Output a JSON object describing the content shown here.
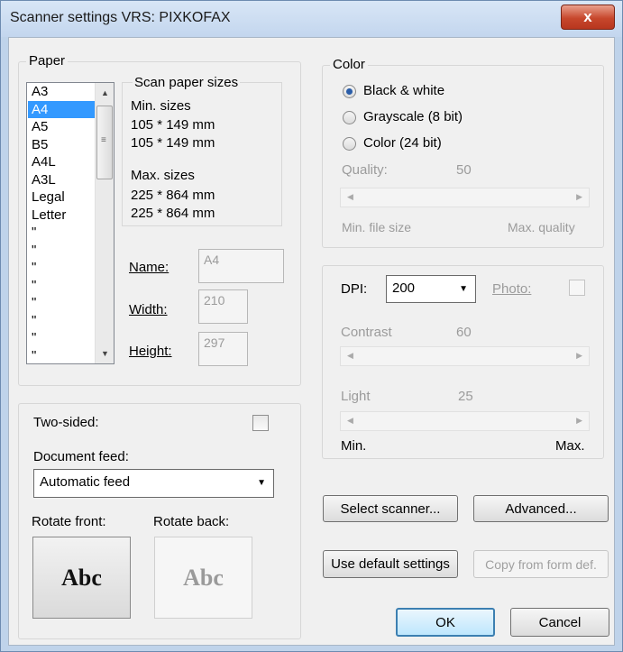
{
  "window": {
    "title": "Scanner settings  VRS: PIXKOFAX",
    "close_label": "x"
  },
  "paper": {
    "legend": "Paper",
    "list_items": [
      "A3",
      "A4",
      "A5",
      "B5",
      "A4L",
      "A3L",
      "Legal",
      "Letter",
      "\"",
      "\"",
      "\"",
      "\"",
      "\"",
      "\"",
      "\"",
      "\""
    ],
    "selected_index": 1,
    "sizes_legend": "Scan paper sizes",
    "min_label": "Min. sizes",
    "min_value_1": "105 * 149 mm",
    "min_value_2": "105 * 149 mm",
    "max_label": "Max. sizes",
    "max_value_1": "225 * 864 mm",
    "max_value_2": "225 * 864 mm",
    "name_label": "Name:",
    "name_value": "A4",
    "width_label": "Width:",
    "width_value": "210",
    "height_label": "Height:",
    "height_value": "297"
  },
  "feed": {
    "two_sided_label": "Two-sided:",
    "two_sided_checked": false,
    "document_feed_label": "Document feed:",
    "document_feed_value": "Automatic feed",
    "rotate_front_label": "Rotate front:",
    "rotate_back_label": "Rotate back:",
    "preview_text": "Abc"
  },
  "color": {
    "legend": "Color",
    "options": [
      "Black & white",
      "Grayscale (8 bit)",
      "Color (24 bit)"
    ],
    "selected_index": 0,
    "quality_label": "Quality:",
    "quality_value": "50",
    "min_file_size_label": "Min. file size",
    "max_quality_label": "Max. quality"
  },
  "dpi": {
    "dpi_label": "DPI:",
    "dpi_value": "200",
    "photo_label": "Photo:",
    "photo_checked": false,
    "contrast_label": "Contrast",
    "contrast_value": "60",
    "light_label": "Light",
    "light_value": "25",
    "min_label": "Min.",
    "max_label": "Max."
  },
  "buttons": {
    "select_scanner": "Select scanner...",
    "advanced": "Advanced...",
    "use_default": "Use default settings",
    "copy_from_form": "Copy from form def.",
    "ok": "OK",
    "cancel": "Cancel"
  },
  "colors": {
    "title_bar": "#c9dbef",
    "selection": "#3399ff",
    "close_button": "#c7472c"
  }
}
